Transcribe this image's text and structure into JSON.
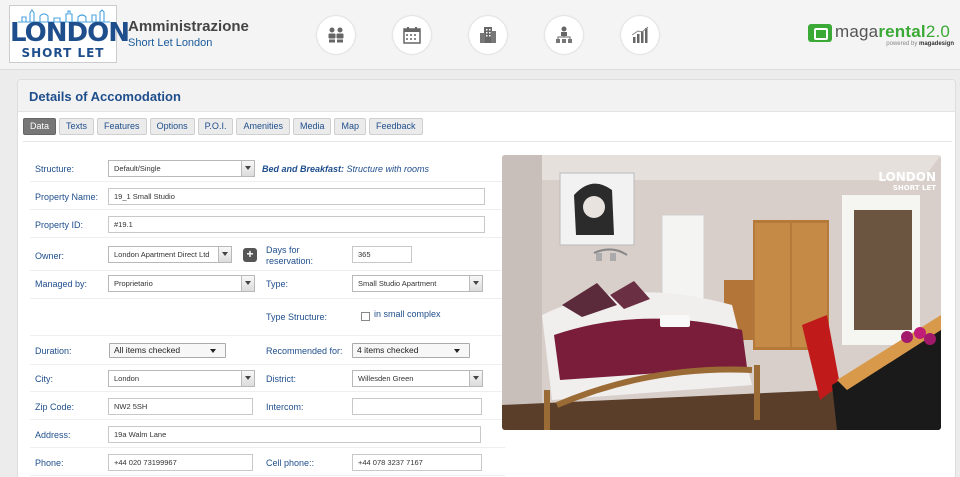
{
  "header": {
    "logo_line1": "LONDON",
    "logo_line2": "SHORT LET",
    "title": "Amministrazione",
    "subtitle": "Short Let London",
    "nav_icons": [
      "users-icon",
      "calendar-icon",
      "building-icon",
      "organization-icon",
      "statistics-icon"
    ],
    "brand_name_prefix": "maga",
    "brand_name_bold": "rental",
    "brand_version": "2.0",
    "brand_powered_prefix": "powered by ",
    "brand_powered_name": "magadesign"
  },
  "panel": {
    "title": "Details of Accomodation",
    "tabs": [
      "Data",
      "Texts",
      "Features",
      "Options",
      "P.O.I.",
      "Amenities",
      "Media",
      "Map",
      "Feedback"
    ],
    "active_tab": "Data"
  },
  "form": {
    "structure": {
      "label": "Structure:",
      "value": "Default/Single",
      "desc_type": "Bed and Breakfast:",
      "desc_text": " Structure with rooms"
    },
    "property_name": {
      "label": "Property Name:",
      "value": "19_1 Small Studio"
    },
    "property_id": {
      "label": "Property ID:",
      "value": "#19.1"
    },
    "owner": {
      "label": "Owner:",
      "value": "London Apartment Direct Ltd"
    },
    "days_for_reservation": {
      "label": "Days for reservation:",
      "value": "365"
    },
    "managed_by": {
      "label": "Managed by:",
      "value": "Proprietario"
    },
    "type": {
      "label": "Type:",
      "value": "Small Studio Apartment"
    },
    "type_structure": {
      "label": "Type Structure:",
      "option": "in small complex"
    },
    "duration": {
      "label": "Duration:",
      "value": "All items checked"
    },
    "recommended_for": {
      "label": "Recommended for:",
      "value": "4 items checked"
    },
    "city": {
      "label": "City:",
      "value": "London"
    },
    "district": {
      "label": "District:",
      "value": "Willesden Green"
    },
    "zip_code": {
      "label": "Zip Code:",
      "value": "NW2 5SH"
    },
    "intercom": {
      "label": "Intercom:",
      "value": ""
    },
    "address": {
      "label": "Address:",
      "value": "19a Walm Lane"
    },
    "phone": {
      "label": "Phone:",
      "value": "+44 020 73199967"
    },
    "cell_phone": {
      "label": "Cell phone::",
      "value": "+44 078 3237 7167"
    }
  },
  "photo": {
    "watermark_line1": "LONDON",
    "watermark_line2": "SHORT LET"
  },
  "colors": {
    "accent_blue": "#1f4e8c",
    "brand_green": "#3aa935",
    "active_tab": "#777777"
  }
}
